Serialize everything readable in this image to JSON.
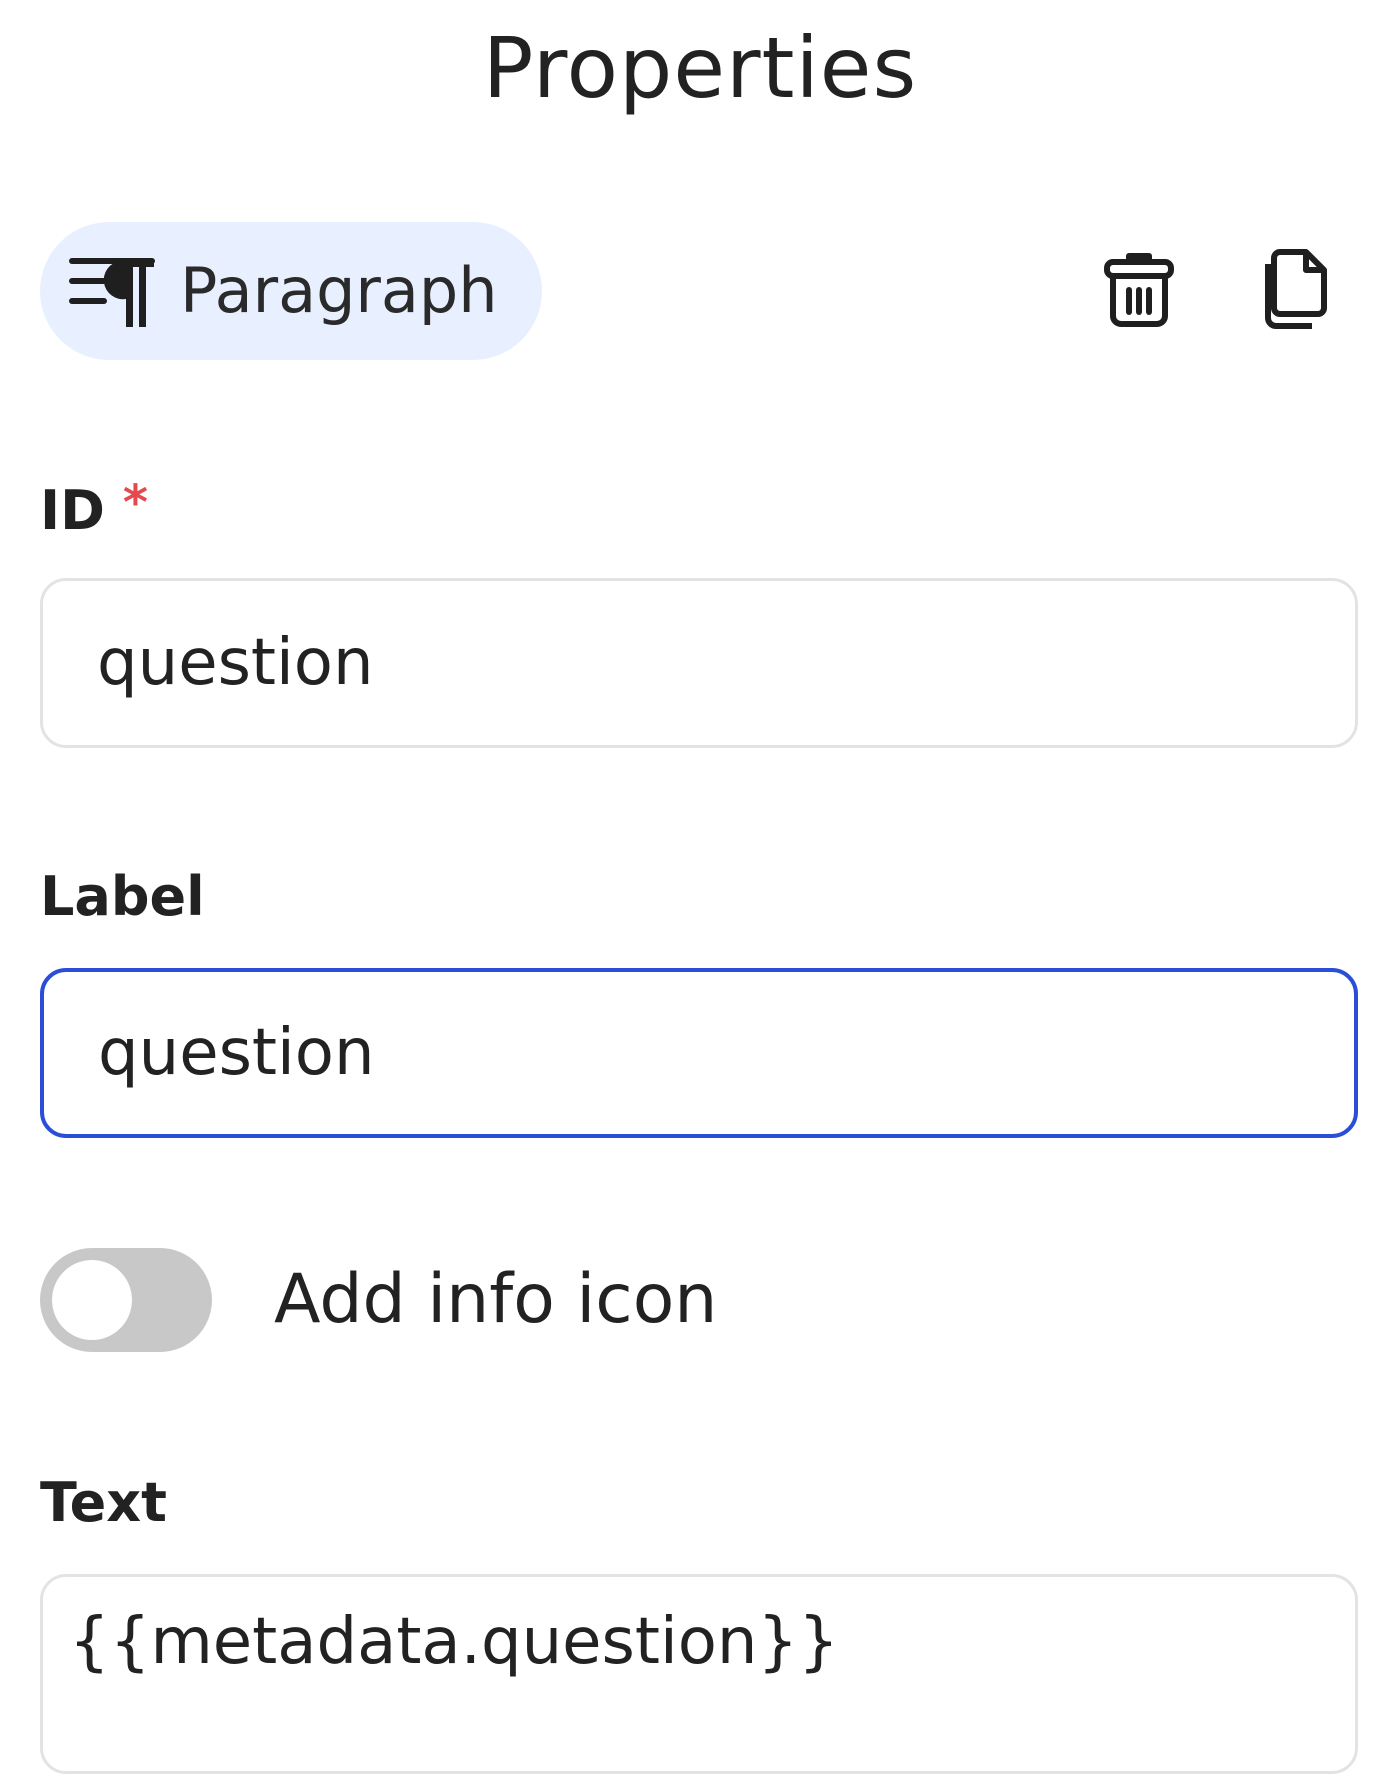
{
  "panel": {
    "title": "Properties"
  },
  "component": {
    "type_label": "Paragraph",
    "type_icon": "paragraph-icon",
    "delete_icon": "trash-icon",
    "duplicate_icon": "copy-icon",
    "chip_color": "#e8efff"
  },
  "fields": {
    "id": {
      "label": "ID",
      "required_marker": "*",
      "value": "question"
    },
    "label": {
      "label": "Label",
      "value": "question",
      "focus_color": "#2a4fd6"
    },
    "info_toggle": {
      "label": "Add info icon",
      "enabled": false
    },
    "text": {
      "label": "Text",
      "value": "{{metadata.question}}"
    }
  },
  "colors": {
    "required": "#e5484d",
    "toggle_off": "#c8c8c8",
    "border": "#e3e3e3"
  }
}
